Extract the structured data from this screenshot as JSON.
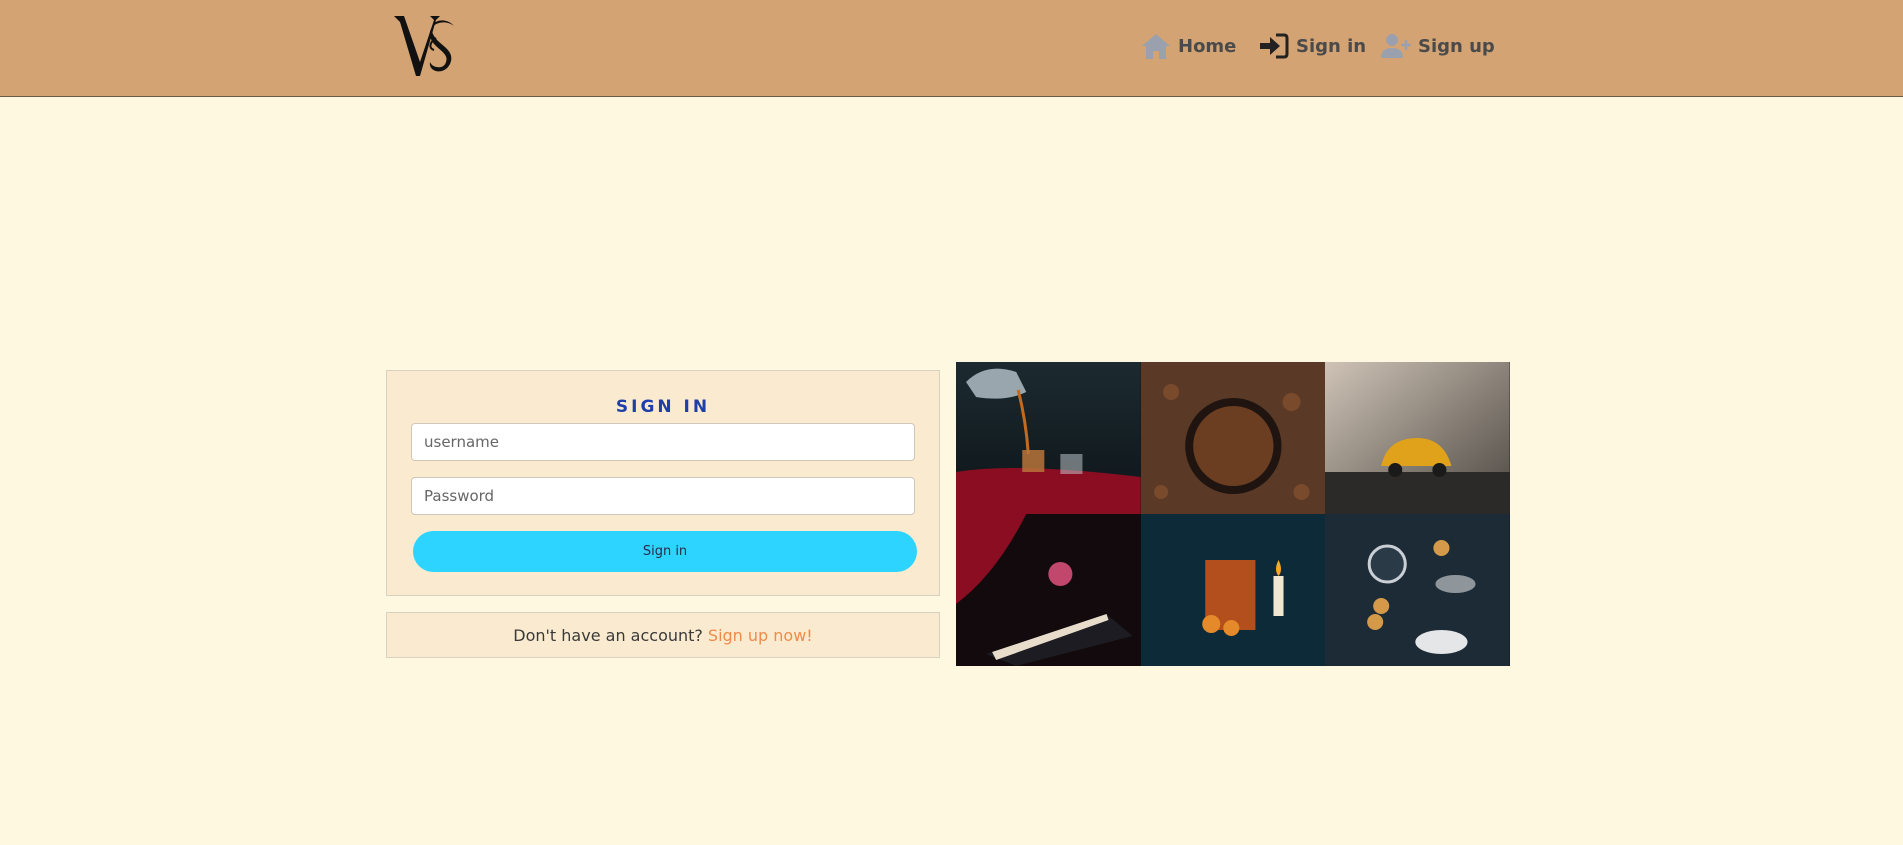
{
  "header": {
    "logo_text": "VS",
    "nav": [
      {
        "label": "Home",
        "icon": "home-icon"
      },
      {
        "label": "Sign in",
        "icon": "sign-in-icon"
      },
      {
        "label": "Sign up",
        "icon": "user-plus-icon"
      }
    ]
  },
  "signin": {
    "title": "SIGN IN",
    "username_placeholder": "username",
    "password_placeholder": "Password",
    "button_label": "Sign in"
  },
  "signup": {
    "prompt": "Don't have an account?",
    "link_label": "Sign up now!"
  },
  "gallery": {
    "images": [
      "teapot-pouring-tea",
      "coffee-beans",
      "toy-car",
      "rose-and-book",
      "iced-tea-with-candle",
      "clock-cookies-cups"
    ]
  },
  "colors": {
    "header_bg": "#d4a373",
    "page_bg": "#fff8e1",
    "card_bg": "#faebd0",
    "title": "#1f3fa8",
    "button": "#2dd4ff",
    "link": "#f08a4b"
  }
}
